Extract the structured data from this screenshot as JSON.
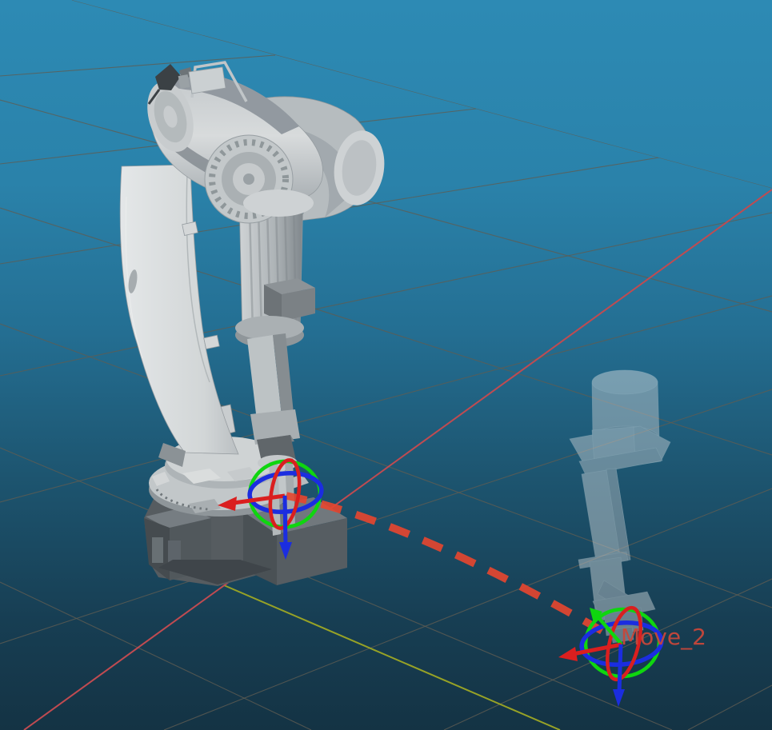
{
  "viewport": {
    "target_label": "Move_2",
    "colors": {
      "bg_top": "#2d8ab4",
      "bg_upper": "#2a82aa",
      "bg_mid": "#246f93",
      "bg_lower": "#1d5570",
      "bg_deep": "#173e53",
      "bg_bottom": "#143344",
      "grid_line": "#5f5c52",
      "world_x_axis": "#c04b51",
      "world_y_axis": "#97a226",
      "path_dash": "#e8462f",
      "gizmo_x": "#da1f1f",
      "gizmo_y": "#0fd60f",
      "gizmo_z": "#1b2de0",
      "label_color": "#c8473a"
    }
  }
}
